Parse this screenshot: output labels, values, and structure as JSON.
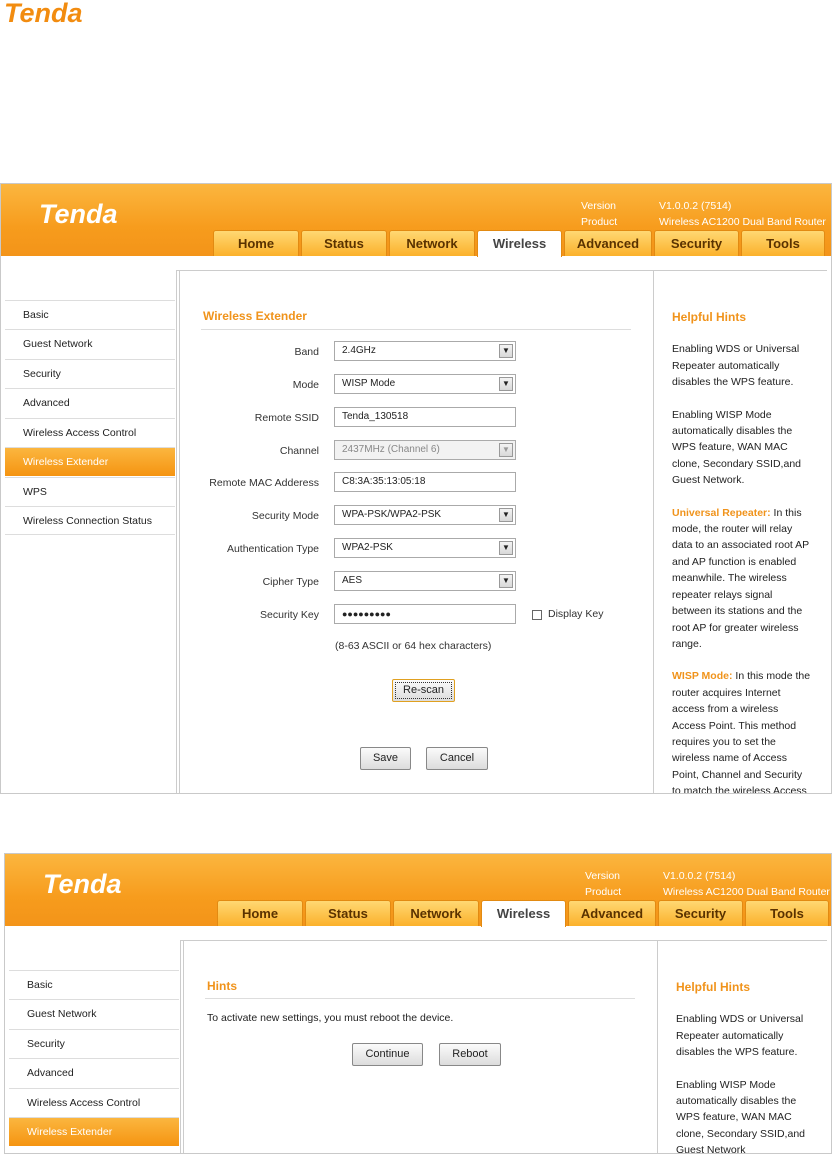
{
  "document": {
    "logo_text": "Tenda"
  },
  "screen1": {
    "brand": "Tenda",
    "version_label": "Version",
    "version_value": "V1.0.0.2 (7514)",
    "product_label": "Product Name",
    "product_value": "Wireless AC1200 Dual Band Router",
    "tabs": [
      "Home",
      "Status",
      "Network",
      "Wireless",
      "Advanced",
      "Security",
      "Tools"
    ],
    "active_tab": "Wireless",
    "sidebar": [
      "Basic",
      "Guest Network",
      "Security",
      "Advanced",
      "Wireless Access Control",
      "Wireless Extender",
      "WPS",
      "Wireless Connection Status"
    ],
    "active_sidebar": "Wireless Extender",
    "section_title": "Wireless Extender",
    "form": {
      "band_label": "Band",
      "band_value": "2.4GHz",
      "mode_label": "Mode",
      "mode_value": "WISP Mode",
      "ssid_label": "Remote SSID",
      "ssid_value": "Tenda_130518",
      "channel_label": "Channel",
      "channel_value": "2437MHz (Channel 6)",
      "mac_label": "Remote MAC Adderess",
      "mac_value": "C8:3A:35:13:05:18",
      "secmode_label": "Security Mode",
      "secmode_value": "WPA-PSK/WPA2-PSK",
      "auth_label": "Authentication Type",
      "auth_value": "WPA2-PSK",
      "cipher_label": "Cipher Type",
      "cipher_value": "AES",
      "key_label": "Security Key",
      "key_value": "●●●●●●●●●",
      "display_key_label": "Display Key",
      "key_hint": "(8-63 ASCII or 64 hex characters)"
    },
    "rescan_label": "Re-scan",
    "save_label": "Save",
    "cancel_label": "Cancel",
    "hints_title": "Helpful Hints",
    "hint1": "Enabling WDS or Universal Repeater automatically disables the WPS feature.",
    "hint2": "Enabling WISP Mode automatically disables the WPS feature, WAN MAC clone, Secondary SSID,and Guest Network.",
    "hint3_title": "Universal Repeater:",
    "hint3_body": " In this mode, the router will relay data to an associated root AP and AP function is enabled meanwhile. The wireless repeater relays signal between its stations and the root AP for greater wireless range.",
    "hint4_title": "WISP Mode:",
    "hint4_body": " In this mode the router acquires Internet access from a wireless Access Point. This method requires you to set the wireless name of Access Point, Channel and Security to match the wireless Access"
  },
  "screen2": {
    "brand": "Tenda",
    "version_label": "Version",
    "version_value": "V1.0.0.2 (7514)",
    "product_label": "Product Name",
    "product_value": "Wireless AC1200 Dual Band Router",
    "tabs": [
      "Home",
      "Status",
      "Network",
      "Wireless",
      "Advanced",
      "Security",
      "Tools"
    ],
    "sidebar": [
      "Basic",
      "Guest Network",
      "Security",
      "Advanced",
      "Wireless Access Control",
      "Wireless Extender"
    ],
    "section_title": "Hints",
    "message": "To activate new settings, you must reboot the device.",
    "continue_label": "Continue",
    "reboot_label": "Reboot",
    "hints_title": "Helpful Hints",
    "hint1": "Enabling WDS or Universal Repeater automatically disables the WPS feature.",
    "hint2": "Enabling WISP Mode automatically disables the WPS feature, WAN MAC clone, Secondary SSID,and Guest Network"
  },
  "colors": {
    "accent": "#f0931b",
    "banner": "#f79c1d",
    "tab_bg": "#fbb12b"
  }
}
